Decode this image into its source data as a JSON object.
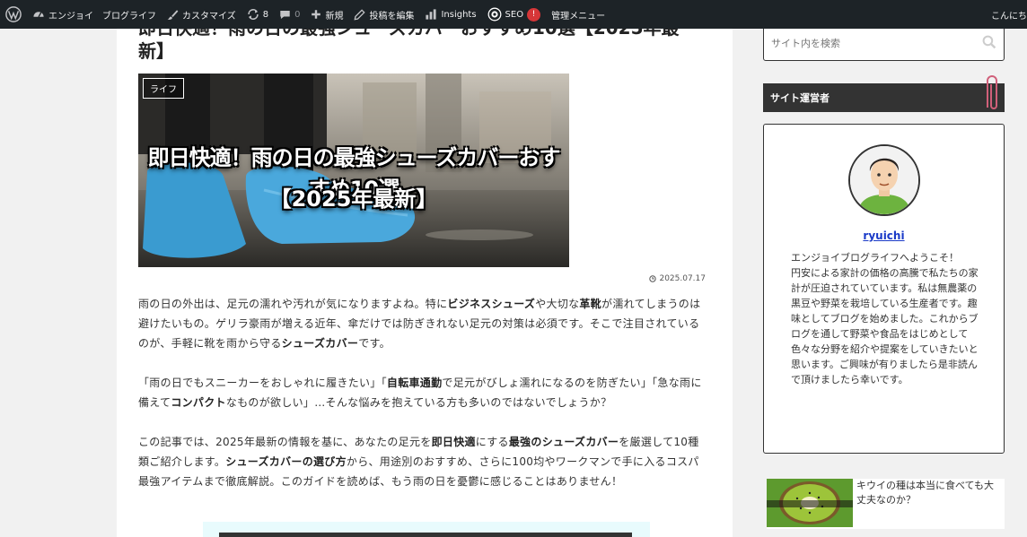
{
  "adminbar": {
    "site_name": "エンジョイ　ブログライフ",
    "customize": "カスタマイズ",
    "updates_count": "8",
    "comments_count": "0",
    "new_label": "新規",
    "edit_post": "投稿を編集",
    "insights": "Insights",
    "seo": "SEO",
    "seo_badge": "!",
    "admin_menu": "管理メニュー",
    "greeting": "こんにち"
  },
  "post": {
    "title_top": "即日快適！雨の日の最強シューズカバーおすすめ10選【2025年最",
    "title_bottom": "新】",
    "category": "ライフ",
    "eyecatch_line1": "即日快適！雨の日の最強シューズカバーおすすめ10選",
    "eyecatch_line2": "【2025年最新】",
    "date": "2025.07.17",
    "p1": [
      "雨の日の外出は、足元の濡れや汚れが気になりますよね。特に",
      "ビジネスシューズ",
      "や大切な",
      "革靴",
      "が濡れてしまうのは避けたいもの。ゲリラ豪雨が増える近年、傘だけでは防ぎきれない足元の対策は必須です。そこで注目されているのが、手軽に靴を雨から守る",
      "シューズカバー",
      "です。"
    ],
    "p2": [
      "「雨の日でもスニーカーをおしゃれに履きたい」「",
      "自転車通勤",
      "で足元がびしょ濡れになるのを防ぎたい」「急な雨に備えて",
      "コンパクト",
      "なものが欲しい」…そんな悩みを抱えている方も多いのではないでしょうか？"
    ],
    "p3": [
      "この記事では、2025年最新の情報を基に、あなたの足元を",
      "即日快適",
      "にする",
      "最強のシューズカバー",
      "を厳選して10種類ご紹介します。",
      "シューズカバーの選び方",
      "から、用途別のおすすめ、さらに100均やワークマンで手に入るコスパ最強アイテムまで徹底解説。このガイドを読めば、もう雨の日を憂鬱に感じることはありません！"
    ]
  },
  "sidebar": {
    "search_placeholder": "サイト内を検索",
    "widget_title": "サイト運営者",
    "author_name": "ryuichi",
    "author_desc": "エンジョイブログライフへようこそ！\n円安による家計の価格の高騰で私たちの家計が圧迫されていています。私は無農薬の黒豆や野菜を栽培している生産者です。趣味としてブログを始めました。これからブログを通して野菜や食品をはじめとして色々な分野を紹介や提案をしていきたいと思います。ご興味が有りましたら是非読んで頂けましたら幸いです。",
    "related_title": "キウイの種は本当に食べても大丈夫なのか？"
  }
}
